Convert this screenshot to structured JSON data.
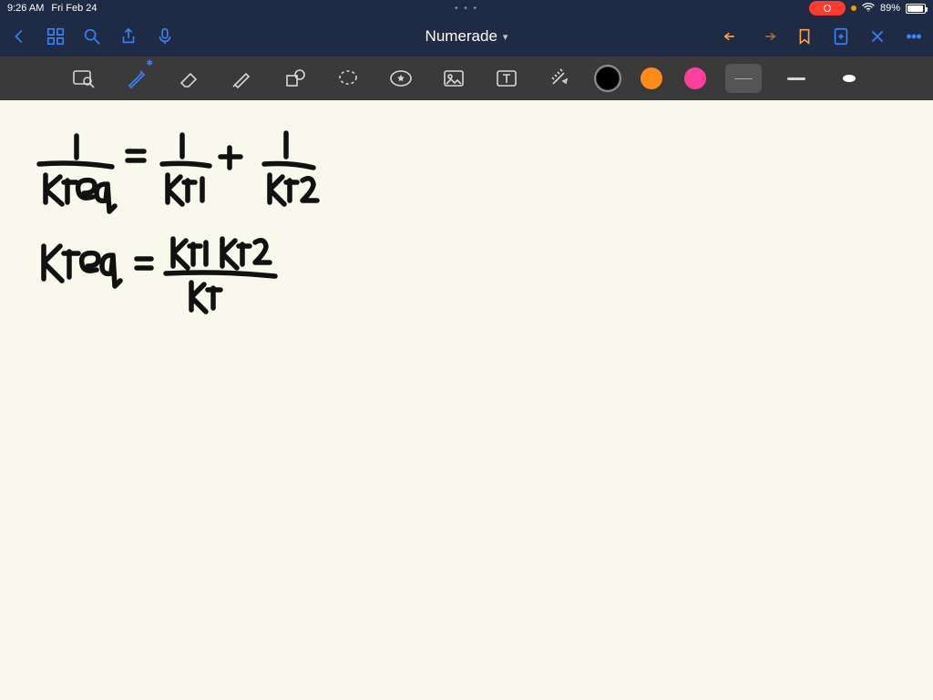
{
  "status": {
    "time": "9:26 AM",
    "date": "Fri Feb 24",
    "ellipsis": "• • •",
    "battery_pct": "89%"
  },
  "nav": {
    "title": "Numerade",
    "back": "back",
    "apps": "apps",
    "search": "search",
    "share": "share",
    "mic": "microphone",
    "undo": "undo",
    "redo": "redo",
    "bookmark": "bookmark",
    "add_page": "add page",
    "close": "close",
    "more": "more"
  },
  "toolbar": {
    "zoom": "zoom",
    "pen": "pen",
    "eraser": "eraser",
    "highlighter": "highlighter",
    "shape": "shape",
    "lasso": "lasso",
    "favorite": "favorite",
    "image": "image",
    "text": "text",
    "ruler": "ruler",
    "colors": {
      "black": "#000000",
      "orange": "#ff8c1a",
      "pink": "#ff3f9d"
    },
    "stroke_thin": "thin",
    "stroke_med": "medium",
    "stroke_tip": "round tip"
  },
  "canvas": {
    "eq1_num": "1",
    "eq1_den": "Kteq",
    "eq_sign": "=",
    "eq1_t1_num": "1",
    "eq1_t1_den": "Kt1",
    "plus": "+",
    "eq1_t2_num": "1",
    "eq1_t2_den": "Kt2",
    "eq2_lhs": "Kteq",
    "eq2_rhs_num": "Kt1 Kt2",
    "eq2_rhs_den": "Kt"
  }
}
